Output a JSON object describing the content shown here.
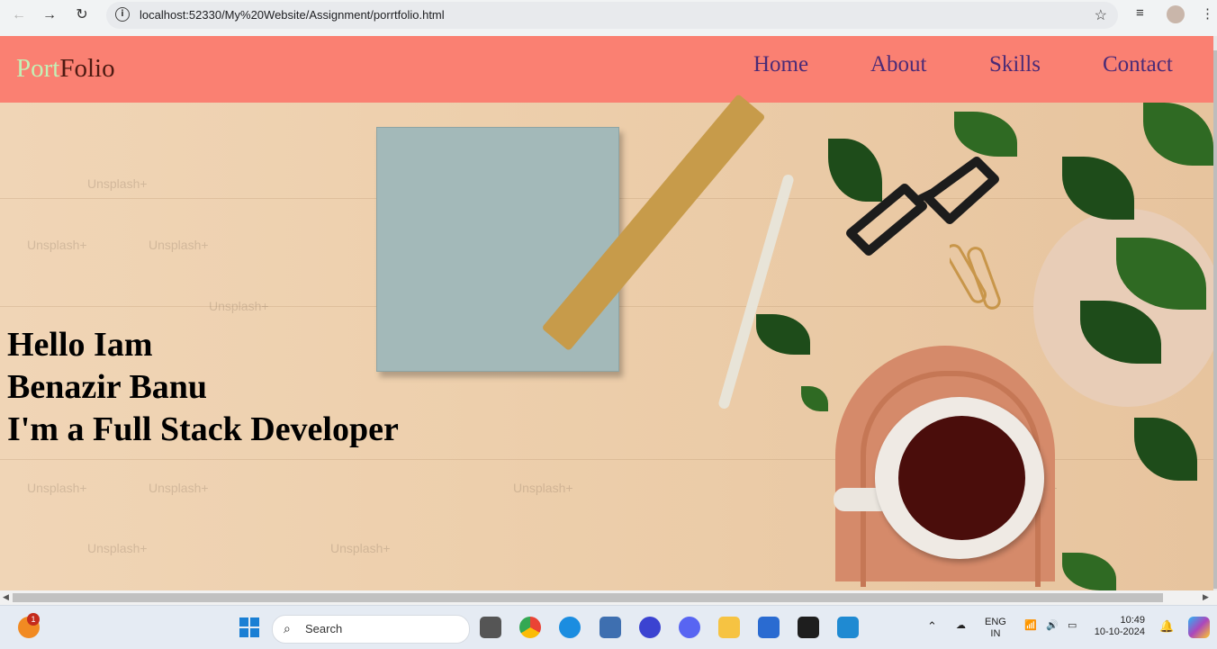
{
  "browser": {
    "url": "localhost:52330/My%20Website/Assignment/porrtfolio.html",
    "back_icon": "arrow-left-icon",
    "forward_icon": "arrow-right-icon",
    "reload_icon": "reload-icon",
    "bookmark_icon": "star-icon"
  },
  "site": {
    "logo_part1": "Port",
    "logo_part2": "Folio",
    "nav": [
      "Home",
      "About",
      "Skills",
      "Contact"
    ],
    "colors": {
      "header_bg": "#fa8072",
      "logo_part1": "#c3f0b5",
      "logo_part2": "#4d1a12",
      "nav_text": "#4b2b76"
    }
  },
  "hero": {
    "line1": "Hello Iam",
    "line2": "Benazir Banu",
    "line3": "I'm a Full Stack Developer",
    "watermark": "Unsplash+"
  },
  "taskbar": {
    "notification_count": "1",
    "search_placeholder": "Search",
    "language_line1": "ENG",
    "language_line2": "IN",
    "time": "10:49",
    "date": "10-10-2024"
  }
}
